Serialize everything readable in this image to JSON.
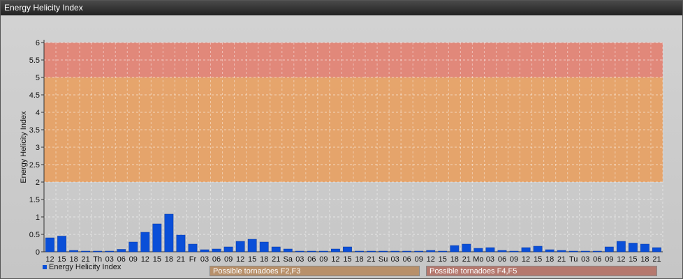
{
  "window": {
    "title": "Energy Helicity Index"
  },
  "chart_data": {
    "type": "bar",
    "ylabel": "Energy Helicity Index",
    "ylim": [
      0,
      6
    ],
    "yticks": [
      "0",
      "0.5",
      "1",
      "1.5",
      "2",
      "2.5",
      "3",
      "3.5",
      "4",
      "4.5",
      "5",
      "5.5",
      "6"
    ],
    "categories": [
      "12",
      "15",
      "18",
      "21",
      "Th",
      "03",
      "06",
      "09",
      "12",
      "15",
      "18",
      "21",
      "Fr",
      "03",
      "06",
      "09",
      "12",
      "15",
      "18",
      "21",
      "Sa",
      "03",
      "06",
      "09",
      "12",
      "15",
      "18",
      "21",
      "Su",
      "03",
      "06",
      "09",
      "12",
      "15",
      "18",
      "21",
      "Mo",
      "03",
      "06",
      "09",
      "12",
      "15",
      "18",
      "21",
      "Tu",
      "03",
      "06",
      "09",
      "12",
      "15",
      "18",
      "21"
    ],
    "series": [
      {
        "name": "Energy Helicity Index",
        "color": "#0a4fd8",
        "values": [
          0.4,
          0.45,
          0.04,
          0.02,
          0.02,
          0.02,
          0.07,
          0.28,
          0.56,
          0.8,
          1.08,
          0.48,
          0.22,
          0.06,
          0.08,
          0.14,
          0.3,
          0.36,
          0.28,
          0.14,
          0.08,
          0.02,
          0.02,
          0.02,
          0.08,
          0.14,
          0.02,
          0.02,
          0.02,
          0.02,
          0.02,
          0.02,
          0.04,
          0.02,
          0.18,
          0.22,
          0.1,
          0.12,
          0.04,
          0.02,
          0.12,
          0.16,
          0.06,
          0.04,
          0.02,
          0.02,
          0.02,
          0.14,
          0.3,
          0.25,
          0.22,
          0.12
        ]
      }
    ],
    "bands": [
      {
        "from": 2,
        "to": 5,
        "color": "#e8a060",
        "label": "Possible tornadoes F2,F3"
      },
      {
        "from": 5,
        "to": 6,
        "color": "#e28070",
        "label": "Possible tornadoes F4,F5"
      }
    ],
    "grid": true,
    "legend": "bottom-left"
  }
}
